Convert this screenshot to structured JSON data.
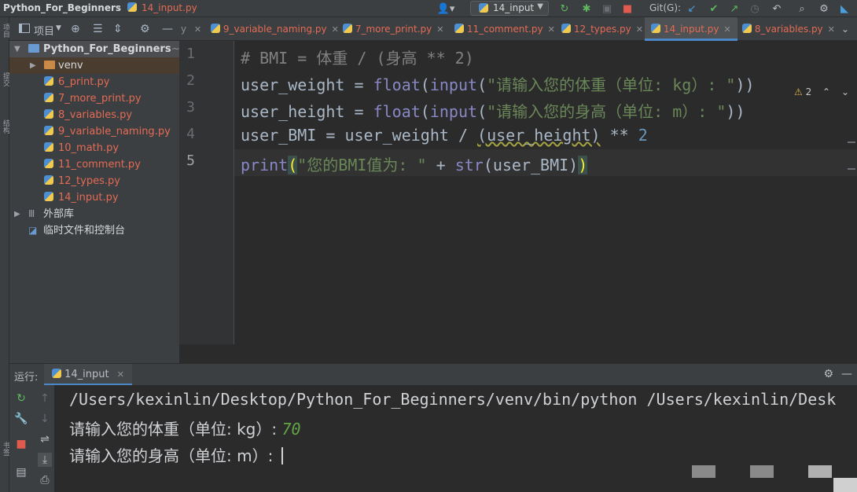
{
  "breadcrumb": {
    "project": "Python_For_Beginners",
    "file": "14_input.py"
  },
  "run_config": {
    "label": "14_input"
  },
  "git": {
    "label": "Git(G):"
  },
  "project_panel": {
    "title": "项目"
  },
  "tree": {
    "root": "Python_For_Beginners",
    "root_suffix": "~",
    "items": [
      {
        "label": "venv"
      },
      {
        "label": "6_print.py"
      },
      {
        "label": "7_more_print.py"
      },
      {
        "label": "8_variables.py"
      },
      {
        "label": "9_variable_naming.py"
      },
      {
        "label": "10_math.py"
      },
      {
        "label": "11_comment.py"
      },
      {
        "label": "12_types.py"
      },
      {
        "label": "14_input.py"
      },
      {
        "label": "外部库"
      },
      {
        "label": "临时文件和控制台"
      }
    ]
  },
  "tabs": [
    {
      "label": "9_variable_naming.py"
    },
    {
      "label": "7_more_print.py"
    },
    {
      "label": "11_comment.py"
    },
    {
      "label": "12_types.py"
    },
    {
      "label": "14_input.py"
    },
    {
      "label": "8_variables.py"
    }
  ],
  "editor": {
    "line_numbers": [
      "1",
      "2",
      "3",
      "4",
      "5"
    ],
    "warnings": "2",
    "line1": {
      "comment": "# BMI = 体重 / (身高 ** 2)"
    },
    "line2": {
      "var": "user_weight = ",
      "f1": "float",
      "p1": "(",
      "f2": "input",
      "p2": "(",
      "s": "\"请输入您的体重（单位: kg）: \"",
      "end": "))"
    },
    "line3": {
      "var": "user_height = ",
      "f1": "float",
      "p1": "(",
      "f2": "input",
      "p2": "(",
      "s": "\"请输入您的身高（单位: m）: \"",
      "end": "))"
    },
    "line4": {
      "a": "user_BMI = user_weight / ",
      "b": "(user_height)",
      "c": " ** ",
      "n": "2"
    },
    "line5": {
      "f": "print",
      "o": "(",
      "s": "\"您的BMI值为: \"",
      "plus": " + ",
      "f2": "str",
      "arg": "(user_BMI)",
      "c": ")"
    }
  },
  "run_panel": {
    "label": "运行:",
    "tab": "14_input",
    "lines": {
      "cmd": "/Users/kexinlin/Desktop/Python_For_Beginners/venv/bin/python /Users/kexinlin/Desk",
      "prompt1": "请输入您的体重（单位: kg）: ",
      "value1": "70",
      "prompt2": "请输入您的身高（单位: m）: "
    }
  },
  "colors": {
    "accent": "#4a88c7",
    "modified_file": "#e36b55",
    "string": "#6a8759",
    "input_value": "#62a546"
  }
}
